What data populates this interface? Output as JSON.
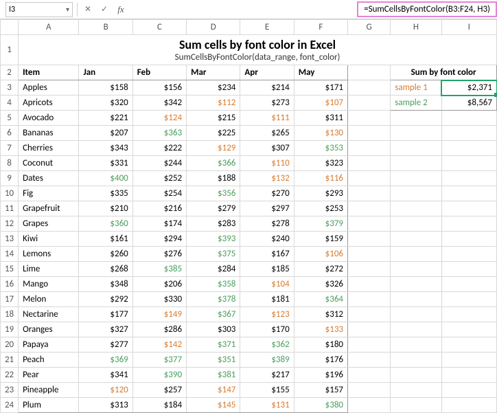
{
  "nameBox": "I3",
  "formula": "=SumCellsByFontColor(B3:F24, H3)",
  "cols": [
    "A",
    "B",
    "C",
    "D",
    "E",
    "F",
    "G",
    "H",
    "I"
  ],
  "title": "Sum cells by font color in Excel",
  "subtitle": "SumCellsByFontColor(data_range, font_color)",
  "headers": [
    "Item",
    "Jan",
    "Feb",
    "Mar",
    "Apr",
    "May"
  ],
  "sumHeader": "Sum by font color",
  "samples": [
    {
      "label": "sample 1",
      "value": "$2,371",
      "cls": "orange"
    },
    {
      "label": "sample 2",
      "value": "$8,567",
      "cls": "green"
    }
  ],
  "rows": [
    {
      "n": 3,
      "item": "Apples",
      "vals": [
        {
          "t": "$158",
          "c": "black"
        },
        {
          "t": "$156",
          "c": "black"
        },
        {
          "t": "$234",
          "c": "black"
        },
        {
          "t": "$214",
          "c": "black"
        },
        {
          "t": "$171",
          "c": "black"
        }
      ]
    },
    {
      "n": 4,
      "item": "Apricots",
      "vals": [
        {
          "t": "$320",
          "c": "black"
        },
        {
          "t": "$342",
          "c": "black"
        },
        {
          "t": "$112",
          "c": "orange"
        },
        {
          "t": "$273",
          "c": "black"
        },
        {
          "t": "$107",
          "c": "orange"
        }
      ]
    },
    {
      "n": 5,
      "item": "Avocado",
      "vals": [
        {
          "t": "$221",
          "c": "black"
        },
        {
          "t": "$124",
          "c": "orange"
        },
        {
          "t": "$215",
          "c": "black"
        },
        {
          "t": "$111",
          "c": "orange"
        },
        {
          "t": "$311",
          "c": "black"
        }
      ]
    },
    {
      "n": 6,
      "item": "Bananas",
      "vals": [
        {
          "t": "$207",
          "c": "black"
        },
        {
          "t": "$363",
          "c": "green"
        },
        {
          "t": "$225",
          "c": "black"
        },
        {
          "t": "$265",
          "c": "black"
        },
        {
          "t": "$130",
          "c": "orange"
        }
      ]
    },
    {
      "n": 7,
      "item": "Cherries",
      "vals": [
        {
          "t": "$343",
          "c": "black"
        },
        {
          "t": "$222",
          "c": "black"
        },
        {
          "t": "$129",
          "c": "orange"
        },
        {
          "t": "$307",
          "c": "black"
        },
        {
          "t": "$353",
          "c": "green"
        }
      ]
    },
    {
      "n": 8,
      "item": "Coconut",
      "vals": [
        {
          "t": "$331",
          "c": "black"
        },
        {
          "t": "$244",
          "c": "black"
        },
        {
          "t": "$366",
          "c": "green"
        },
        {
          "t": "$110",
          "c": "orange"
        },
        {
          "t": "$323",
          "c": "black"
        }
      ]
    },
    {
      "n": 9,
      "item": "Dates",
      "vals": [
        {
          "t": "$400",
          "c": "green"
        },
        {
          "t": "$252",
          "c": "black"
        },
        {
          "t": "$188",
          "c": "black"
        },
        {
          "t": "$132",
          "c": "orange"
        },
        {
          "t": "$116",
          "c": "orange"
        }
      ]
    },
    {
      "n": 10,
      "item": "Fig",
      "vals": [
        {
          "t": "$335",
          "c": "black"
        },
        {
          "t": "$254",
          "c": "black"
        },
        {
          "t": "$356",
          "c": "green"
        },
        {
          "t": "$270",
          "c": "black"
        },
        {
          "t": "$293",
          "c": "black"
        }
      ]
    },
    {
      "n": 11,
      "item": "Grapefruit",
      "vals": [
        {
          "t": "$210",
          "c": "black"
        },
        {
          "t": "$216",
          "c": "black"
        },
        {
          "t": "$279",
          "c": "black"
        },
        {
          "t": "$297",
          "c": "black"
        },
        {
          "t": "$253",
          "c": "black"
        }
      ]
    },
    {
      "n": 12,
      "item": "Grapes",
      "vals": [
        {
          "t": "$360",
          "c": "green"
        },
        {
          "t": "$174",
          "c": "black"
        },
        {
          "t": "$283",
          "c": "black"
        },
        {
          "t": "$278",
          "c": "black"
        },
        {
          "t": "$379",
          "c": "green"
        }
      ]
    },
    {
      "n": 13,
      "item": "Kiwi",
      "vals": [
        {
          "t": "$161",
          "c": "black"
        },
        {
          "t": "$294",
          "c": "black"
        },
        {
          "t": "$393",
          "c": "green"
        },
        {
          "t": "$240",
          "c": "black"
        },
        {
          "t": "$159",
          "c": "black"
        }
      ]
    },
    {
      "n": 14,
      "item": "Lemons",
      "vals": [
        {
          "t": "$260",
          "c": "black"
        },
        {
          "t": "$276",
          "c": "black"
        },
        {
          "t": "$375",
          "c": "green"
        },
        {
          "t": "$167",
          "c": "black"
        },
        {
          "t": "$106",
          "c": "orange"
        }
      ]
    },
    {
      "n": 15,
      "item": "Lime",
      "vals": [
        {
          "t": "$268",
          "c": "black"
        },
        {
          "t": "$385",
          "c": "green"
        },
        {
          "t": "$284",
          "c": "black"
        },
        {
          "t": "$185",
          "c": "black"
        },
        {
          "t": "$272",
          "c": "black"
        }
      ]
    },
    {
      "n": 16,
      "item": "Mango",
      "vals": [
        {
          "t": "$348",
          "c": "black"
        },
        {
          "t": "$206",
          "c": "black"
        },
        {
          "t": "$358",
          "c": "green"
        },
        {
          "t": "$104",
          "c": "orange"
        },
        {
          "t": "$326",
          "c": "black"
        }
      ]
    },
    {
      "n": 17,
      "item": "Melon",
      "vals": [
        {
          "t": "$292",
          "c": "black"
        },
        {
          "t": "$330",
          "c": "black"
        },
        {
          "t": "$378",
          "c": "green"
        },
        {
          "t": "$181",
          "c": "black"
        },
        {
          "t": "$364",
          "c": "green"
        }
      ]
    },
    {
      "n": 18,
      "item": "Nectarine",
      "vals": [
        {
          "t": "$177",
          "c": "black"
        },
        {
          "t": "$149",
          "c": "orange"
        },
        {
          "t": "$367",
          "c": "green"
        },
        {
          "t": "$123",
          "c": "orange"
        },
        {
          "t": "$312",
          "c": "black"
        }
      ]
    },
    {
      "n": 19,
      "item": "Oranges",
      "vals": [
        {
          "t": "$327",
          "c": "black"
        },
        {
          "t": "$286",
          "c": "black"
        },
        {
          "t": "$303",
          "c": "black"
        },
        {
          "t": "$170",
          "c": "black"
        },
        {
          "t": "$133",
          "c": "orange"
        }
      ]
    },
    {
      "n": 20,
      "item": "Papaya",
      "vals": [
        {
          "t": "$277",
          "c": "black"
        },
        {
          "t": "$142",
          "c": "orange"
        },
        {
          "t": "$371",
          "c": "green"
        },
        {
          "t": "$362",
          "c": "green"
        },
        {
          "t": "$180",
          "c": "black"
        }
      ]
    },
    {
      "n": 21,
      "item": "Peach",
      "vals": [
        {
          "t": "$369",
          "c": "green"
        },
        {
          "t": "$377",
          "c": "green"
        },
        {
          "t": "$351",
          "c": "green"
        },
        {
          "t": "$389",
          "c": "green"
        },
        {
          "t": "$176",
          "c": "black"
        }
      ]
    },
    {
      "n": 22,
      "item": "Pear",
      "vals": [
        {
          "t": "$341",
          "c": "black"
        },
        {
          "t": "$390",
          "c": "green"
        },
        {
          "t": "$381",
          "c": "green"
        },
        {
          "t": "$217",
          "c": "black"
        },
        {
          "t": "$196",
          "c": "black"
        }
      ]
    },
    {
      "n": 23,
      "item": "Pineapple",
      "vals": [
        {
          "t": "$120",
          "c": "orange"
        },
        {
          "t": "$257",
          "c": "black"
        },
        {
          "t": "$147",
          "c": "orange"
        },
        {
          "t": "$155",
          "c": "black"
        },
        {
          "t": "$157",
          "c": "black"
        }
      ]
    },
    {
      "n": 24,
      "item": "Plum",
      "vals": [
        {
          "t": "$313",
          "c": "black"
        },
        {
          "t": "$184",
          "c": "black"
        },
        {
          "t": "$145",
          "c": "orange"
        },
        {
          "t": "$131",
          "c": "orange"
        },
        {
          "t": "$380",
          "c": "green"
        }
      ]
    }
  ],
  "chart_data": {
    "type": "table",
    "title": "Sum cells by font color in Excel",
    "columns": [
      "Item",
      "Jan",
      "Feb",
      "Mar",
      "Apr",
      "May"
    ],
    "data": [
      [
        "Apples",
        158,
        156,
        234,
        214,
        171
      ],
      [
        "Apricots",
        320,
        342,
        112,
        273,
        107
      ],
      [
        "Avocado",
        221,
        124,
        215,
        111,
        311
      ],
      [
        "Bananas",
        207,
        363,
        225,
        265,
        130
      ],
      [
        "Cherries",
        343,
        222,
        129,
        307,
        353
      ],
      [
        "Coconut",
        331,
        244,
        366,
        110,
        323
      ],
      [
        "Dates",
        400,
        252,
        188,
        132,
        116
      ],
      [
        "Fig",
        335,
        254,
        356,
        270,
        293
      ],
      [
        "Grapefruit",
        210,
        216,
        279,
        297,
        253
      ],
      [
        "Grapes",
        360,
        174,
        283,
        278,
        379
      ],
      [
        "Kiwi",
        161,
        294,
        393,
        240,
        159
      ],
      [
        "Lemons",
        260,
        276,
        375,
        167,
        106
      ],
      [
        "Lime",
        268,
        385,
        284,
        185,
        272
      ],
      [
        "Mango",
        348,
        206,
        358,
        104,
        326
      ],
      [
        "Melon",
        292,
        330,
        378,
        181,
        364
      ],
      [
        "Nectarine",
        177,
        149,
        367,
        123,
        312
      ],
      [
        "Oranges",
        327,
        286,
        303,
        170,
        133
      ],
      [
        "Papaya",
        277,
        142,
        371,
        362,
        180
      ],
      [
        "Peach",
        369,
        377,
        351,
        389,
        176
      ],
      [
        "Pear",
        341,
        390,
        381,
        217,
        196
      ],
      [
        "Pineapple",
        120,
        257,
        147,
        155,
        157
      ],
      [
        "Plum",
        313,
        184,
        145,
        131,
        380
      ]
    ],
    "summary": {
      "Sum by font color": {
        "sample 1 (orange)": 2371,
        "sample 2 (green)": 8567
      }
    }
  }
}
